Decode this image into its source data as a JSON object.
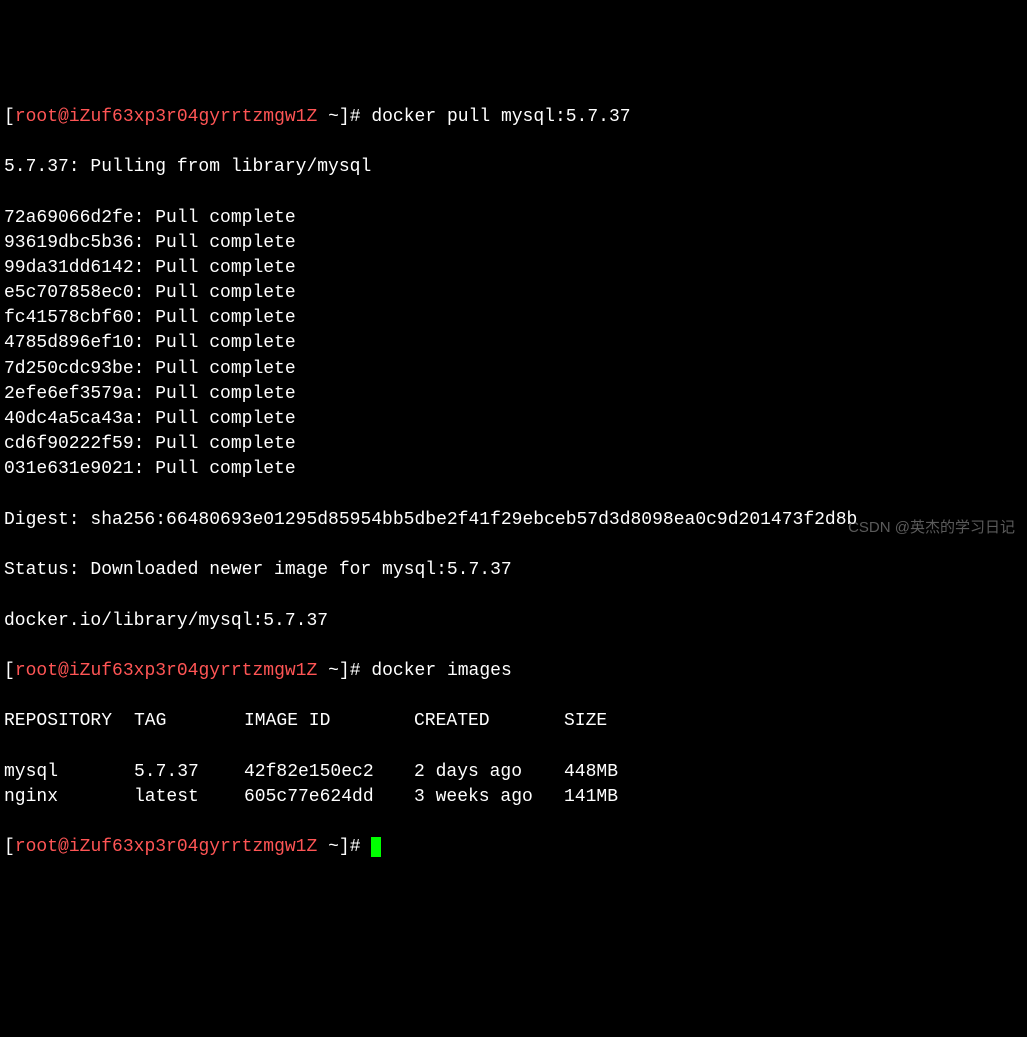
{
  "prompt1": {
    "user": "root",
    "host": "iZuf63xp3r04gyrrtzmgw1Z",
    "path": "~",
    "command": "docker pull mysql:5.7.37"
  },
  "pullOutput": {
    "pullingFrom": "5.7.37: Pulling from library/mysql",
    "layers": [
      {
        "id": "72a69066d2fe",
        "status": "Pull complete"
      },
      {
        "id": "93619dbc5b36",
        "status": "Pull complete"
      },
      {
        "id": "99da31dd6142",
        "status": "Pull complete"
      },
      {
        "id": "e5c707858ec0",
        "status": "Pull complete"
      },
      {
        "id": "fc41578cbf60",
        "status": "Pull complete"
      },
      {
        "id": "4785d896ef10",
        "status": "Pull complete"
      },
      {
        "id": "7d250cdc93be",
        "status": "Pull complete"
      },
      {
        "id": "2efe6ef3579a",
        "status": "Pull complete"
      },
      {
        "id": "40dc4a5ca43a",
        "status": "Pull complete"
      },
      {
        "id": "cd6f90222f59",
        "status": "Pull complete"
      },
      {
        "id": "031e631e9021",
        "status": "Pull complete"
      }
    ],
    "digest": "Digest: sha256:66480693e01295d85954bb5dbe2f41f29ebceb57d3d8098ea0c9d201473f2d8b",
    "status": "Status: Downloaded newer image for mysql:5.7.37",
    "ref": "docker.io/library/mysql:5.7.37"
  },
  "prompt2": {
    "user": "root",
    "host": "iZuf63xp3r04gyrrtzmgw1Z",
    "path": "~",
    "command": "docker images"
  },
  "imagesTable": {
    "headers": {
      "repository": "REPOSITORY",
      "tag": "TAG",
      "imageId": "IMAGE ID",
      "created": "CREATED",
      "size": "SIZE"
    },
    "rows": [
      {
        "repository": "mysql",
        "tag": "5.7.37",
        "imageId": "42f82e150ec2",
        "created": "2 days ago",
        "size": "448MB"
      },
      {
        "repository": "nginx",
        "tag": "latest",
        "imageId": "605c77e624dd",
        "created": "3 weeks ago",
        "size": "141MB"
      }
    ]
  },
  "prompt3": {
    "user": "root",
    "host": "iZuf63xp3r04gyrrtzmgw1Z",
    "path": "~",
    "command": ""
  },
  "watermark": "CSDN @英杰的学习日记"
}
